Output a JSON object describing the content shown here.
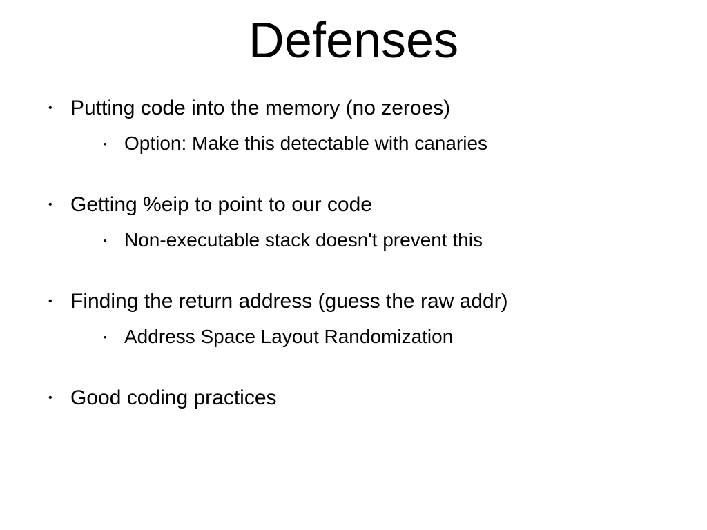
{
  "slide": {
    "title": "Defenses",
    "bullets": [
      {
        "text": "Putting code into the memory (no zeroes)",
        "sub": [
          {
            "text": "Option: Make this detectable with canaries"
          }
        ]
      },
      {
        "text": "Getting %eip to point to our code",
        "sub": [
          {
            "text": "Non-executable stack doesn't prevent this"
          }
        ]
      },
      {
        "text": "Finding the return address (guess the raw addr)",
        "sub": [
          {
            "text": "Address Space Layout Randomization"
          }
        ]
      },
      {
        "text": "Good coding practices",
        "sub": []
      }
    ]
  }
}
